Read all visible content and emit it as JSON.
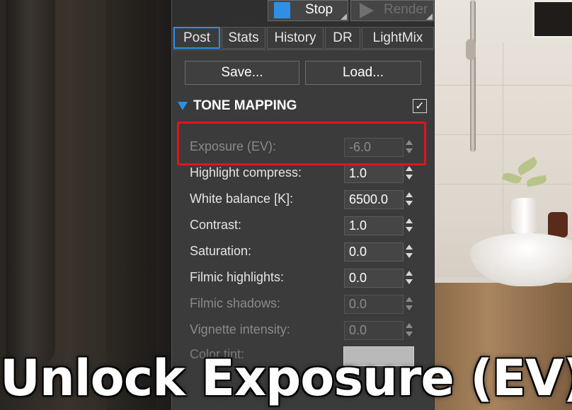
{
  "toolbar": {
    "stop_label": "Stop",
    "render_label": "Render"
  },
  "tabs": [
    {
      "label": "Post",
      "active": true
    },
    {
      "label": "Stats"
    },
    {
      "label": "History"
    },
    {
      "label": "DR"
    },
    {
      "label": "LightMix"
    }
  ],
  "buttons": {
    "save": "Save...",
    "load": "Load..."
  },
  "section": {
    "title": "TONE MAPPING",
    "enabled": true,
    "check_glyph": "✓"
  },
  "params": [
    {
      "label": "Exposure (EV):",
      "value": "-6.0",
      "disabled": true
    },
    {
      "label": "Highlight compress:",
      "value": "1.0"
    },
    {
      "label": "White balance [K]:",
      "value": "6500.0"
    },
    {
      "label": "Contrast:",
      "value": "1.0"
    },
    {
      "label": "Saturation:",
      "value": "0.0"
    },
    {
      "label": "Filmic highlights:",
      "value": "0.0"
    },
    {
      "label": "Filmic shadows:",
      "value": "0.0",
      "disabled": true
    },
    {
      "label": "Vignette intensity:",
      "value": "0.0",
      "disabled": true
    }
  ],
  "color_tint": {
    "label": "Color tint:",
    "swatch_color": "#b9b9b9"
  },
  "caption": "Unlock Exposure (EV)",
  "colors": {
    "accent": "#2e8fe6",
    "highlight": "#e0141c",
    "panel_bg": "#3b3b3b"
  }
}
